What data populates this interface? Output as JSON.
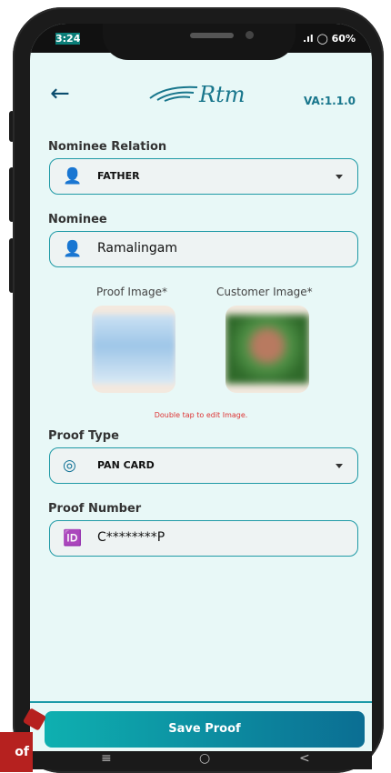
{
  "status_bar": {
    "time": "3:24",
    "battery": "60%"
  },
  "header": {
    "logo_text": "Rtm",
    "version": "VA:1.1.0"
  },
  "form": {
    "nominee_relation": {
      "label": "Nominee Relation",
      "value": "FATHER"
    },
    "nominee": {
      "label": "Nominee",
      "value": "Ramalingam"
    },
    "proof_image_label": "Proof Image*",
    "customer_image_label": "Customer Image*",
    "hint": "Double tap to edit Image.",
    "proof_type": {
      "label": "Proof Type",
      "value": "PAN CARD"
    },
    "proof_number": {
      "label": "Proof Number",
      "value": "C********P"
    }
  },
  "actions": {
    "save_label": "Save Proof"
  },
  "overlay": {
    "cut_text": "of"
  },
  "nav": {
    "menu_glyph": "≡",
    "home_glyph": "○",
    "back_glyph": "<"
  },
  "colors": {
    "accent": "#1f9aa6",
    "background": "#e8f8f7",
    "error": "#d33333"
  }
}
